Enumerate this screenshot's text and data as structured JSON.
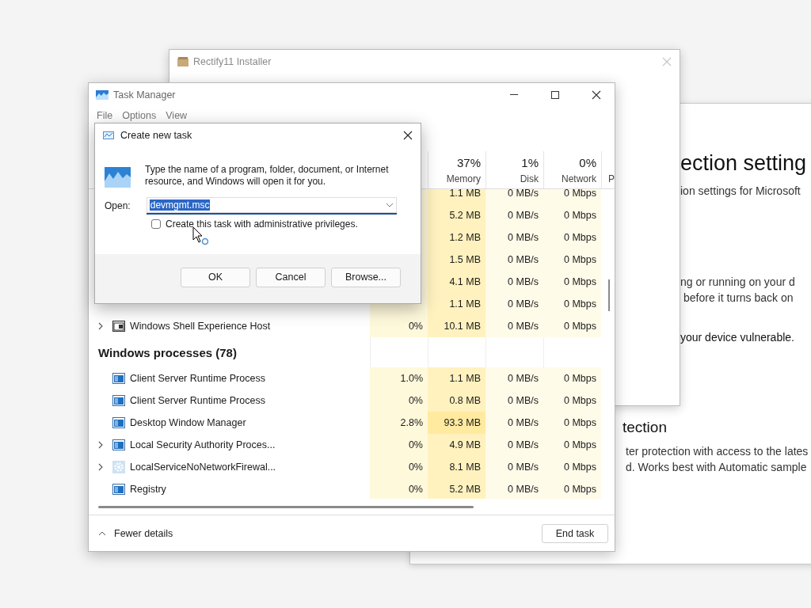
{
  "security_window": {
    "heading": "ection setting",
    "subtitle": "ion settings for Microsoft",
    "paragraph_lines": [
      "ng or running on your d",
      "before it turns back on"
    ],
    "warning": "your device vulnerable.",
    "section_heading": "tection",
    "section_lines": [
      "ter protection with access to the lates",
      "d. Works best with Automatic sample"
    ]
  },
  "installer_window": {
    "title": "Rectify11 Installer"
  },
  "task_manager": {
    "title": "Task Manager",
    "menu": [
      "File",
      "Options",
      "View"
    ],
    "columns": [
      {
        "percent": "37%",
        "label": "Memory"
      },
      {
        "percent": "1%",
        "label": "Disk"
      },
      {
        "percent": "0%",
        "label": "Network"
      },
      {
        "label": "P"
      }
    ],
    "rows": [
      {
        "memory": "1.1 MB",
        "disk": "0 MB/s",
        "network": "0 Mbps"
      },
      {
        "memory": "5.2 MB",
        "disk": "0 MB/s",
        "network": "0 Mbps"
      },
      {
        "memory": "1.2 MB",
        "disk": "0 MB/s",
        "network": "0 Mbps"
      },
      {
        "memory": "1.5 MB",
        "disk": "0 MB/s",
        "network": "0 Mbps"
      },
      {
        "memory": "4.1 MB",
        "disk": "0 MB/s",
        "network": "0 Mbps"
      },
      {
        "memory": "1.1 MB",
        "disk": "0 MB/s",
        "network": "0 Mbps"
      },
      {
        "kind": "shell",
        "expandable": true,
        "name": "Windows Shell Experience Host",
        "cpu": "0%",
        "memory": "10.1 MB",
        "disk": "0 MB/s",
        "network": "0 Mbps"
      }
    ],
    "group": {
      "title": "Windows processes (78)",
      "rows": [
        {
          "kind": "app",
          "expandable": false,
          "name": "Client Server Runtime Process",
          "cpu": "1.0%",
          "memory": "1.1 MB",
          "disk": "0 MB/s",
          "network": "0 Mbps"
        },
        {
          "kind": "app",
          "expandable": false,
          "name": "Client Server Runtime Process",
          "cpu": "0%",
          "memory": "0.8 MB",
          "disk": "0 MB/s",
          "network": "0 Mbps"
        },
        {
          "kind": "app",
          "expandable": false,
          "name": "Desktop Window Manager",
          "cpu": "2.8%",
          "memory": "93.3 MB",
          "disk": "0 MB/s",
          "network": "0 Mbps"
        },
        {
          "kind": "app",
          "expandable": true,
          "name": "Local Security Authority Proces...",
          "cpu": "0%",
          "memory": "4.9 MB",
          "disk": "0 MB/s",
          "network": "0 Mbps"
        },
        {
          "kind": "service",
          "expandable": true,
          "name": "LocalServiceNoNetworkFirewal...",
          "cpu": "0%",
          "memory": "8.1 MB",
          "disk": "0 MB/s",
          "network": "0 Mbps"
        },
        {
          "kind": "app",
          "expandable": false,
          "name": "Registry",
          "cpu": "0%",
          "memory": "5.2 MB",
          "disk": "0 MB/s",
          "network": "0 Mbps"
        }
      ]
    },
    "fewer_details": "Fewer details",
    "end_task": "End task"
  },
  "run_dialog": {
    "title": "Create new task",
    "prompt": "Type the name of a program, folder, document, or Internet resource, and Windows will open it for you.",
    "open_label": "Open:",
    "open_value": "devmgmt.msc",
    "admin": {
      "label": "Create this task with administrative privileges.",
      "checked": false
    },
    "buttons": [
      "OK",
      "Cancel",
      "Browse..."
    ]
  }
}
